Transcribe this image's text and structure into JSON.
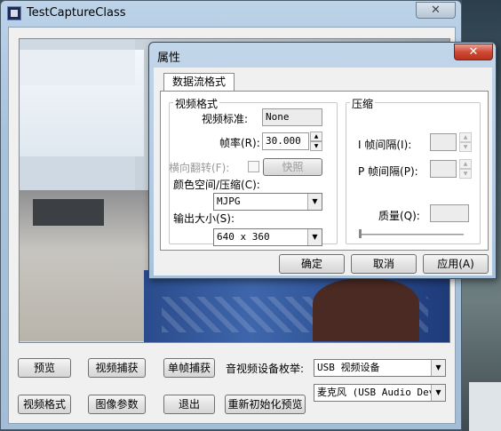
{
  "main_window": {
    "title": "TestCaptureClass",
    "close_glyph": "✕"
  },
  "buttons": {
    "preview": "预览",
    "video_capture": "视频捕获",
    "single_frame": "单帧捕获",
    "video_format": "视频格式",
    "image_params": "图像参数",
    "exit": "退出",
    "reinit_preview": "重新初始化预览"
  },
  "device_enum": {
    "label": "音视频设备枚举:",
    "video_device": "USB 视频设备",
    "audio_device": "麦克风 (USB Audio Devi"
  },
  "dialog": {
    "title": "属性",
    "close_glyph": "✕",
    "tab": "数据流格式",
    "video_format_group": {
      "title": "视频格式",
      "video_standard_label": "视频标准:",
      "video_standard_value": "None",
      "frame_rate_label": "帧率(R):",
      "frame_rate_value": "30.000",
      "flip_label": "横向翻转(F):",
      "snapshot_button": "快照",
      "color_space_label": "颜色空间/压缩(C):",
      "color_space_value": "MJPG",
      "output_size_label": "输出大小(S):",
      "output_size_value": "640 x 360"
    },
    "compression_group": {
      "title": "压缩",
      "i_frame_label": "I 帧间隔(I):",
      "p_frame_label": "P 帧间隔(P):",
      "quality_label": "质量(Q):"
    },
    "ok_button": "确定",
    "cancel_button": "取消",
    "apply_button": "应用(A)"
  },
  "icons": {
    "app": "app-icon",
    "spin_up": "▲",
    "spin_down": "▼",
    "dropdown": "▼"
  }
}
